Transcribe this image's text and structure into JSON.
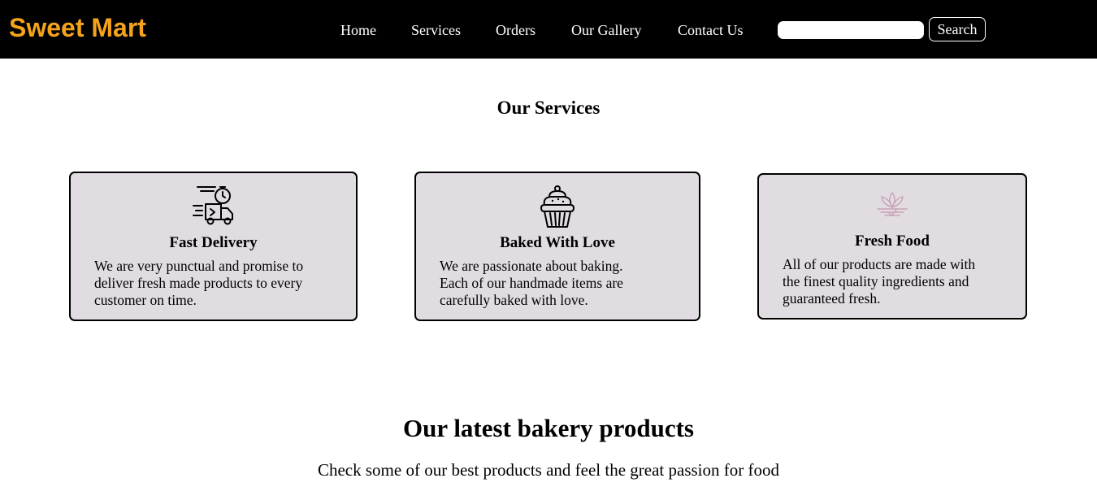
{
  "navbar": {
    "brand": "Sweet Mart",
    "links": [
      "Home",
      "Services",
      "Orders",
      "Our Gallery",
      "Contact Us"
    ],
    "search": {
      "placeholder": "",
      "value": "",
      "button_label": "Search"
    }
  },
  "services": {
    "title": "Our Services",
    "cards": [
      {
        "icon": "delivery-truck-icon",
        "title": "Fast Delivery",
        "lines": [
          "We are very punctual and promise to",
          "deliver fresh made products to every",
          "customer on time."
        ]
      },
      {
        "icon": "cupcake-icon",
        "title": "Baked With Love",
        "lines": [
          "We are passionate about baking.",
          "Each of our handmade items are",
          "carefully baked with love."
        ]
      },
      {
        "icon": "lotus-leaf-icon",
        "title": "Fresh Food",
        "lines": [
          "All of our products are made with",
          "the finest quality ingredients and",
          "guaranteed fresh."
        ]
      }
    ]
  },
  "latest": {
    "title": "Our latest bakery products",
    "subtitle": "Check some of our best products and feel the great passion for food"
  },
  "colors": {
    "navbar_bg": "#000000",
    "brand": "#f5a31a",
    "card_bg": "#e1dce1",
    "card_border": "#000000",
    "fresh_icon": "#c9a1b4"
  }
}
